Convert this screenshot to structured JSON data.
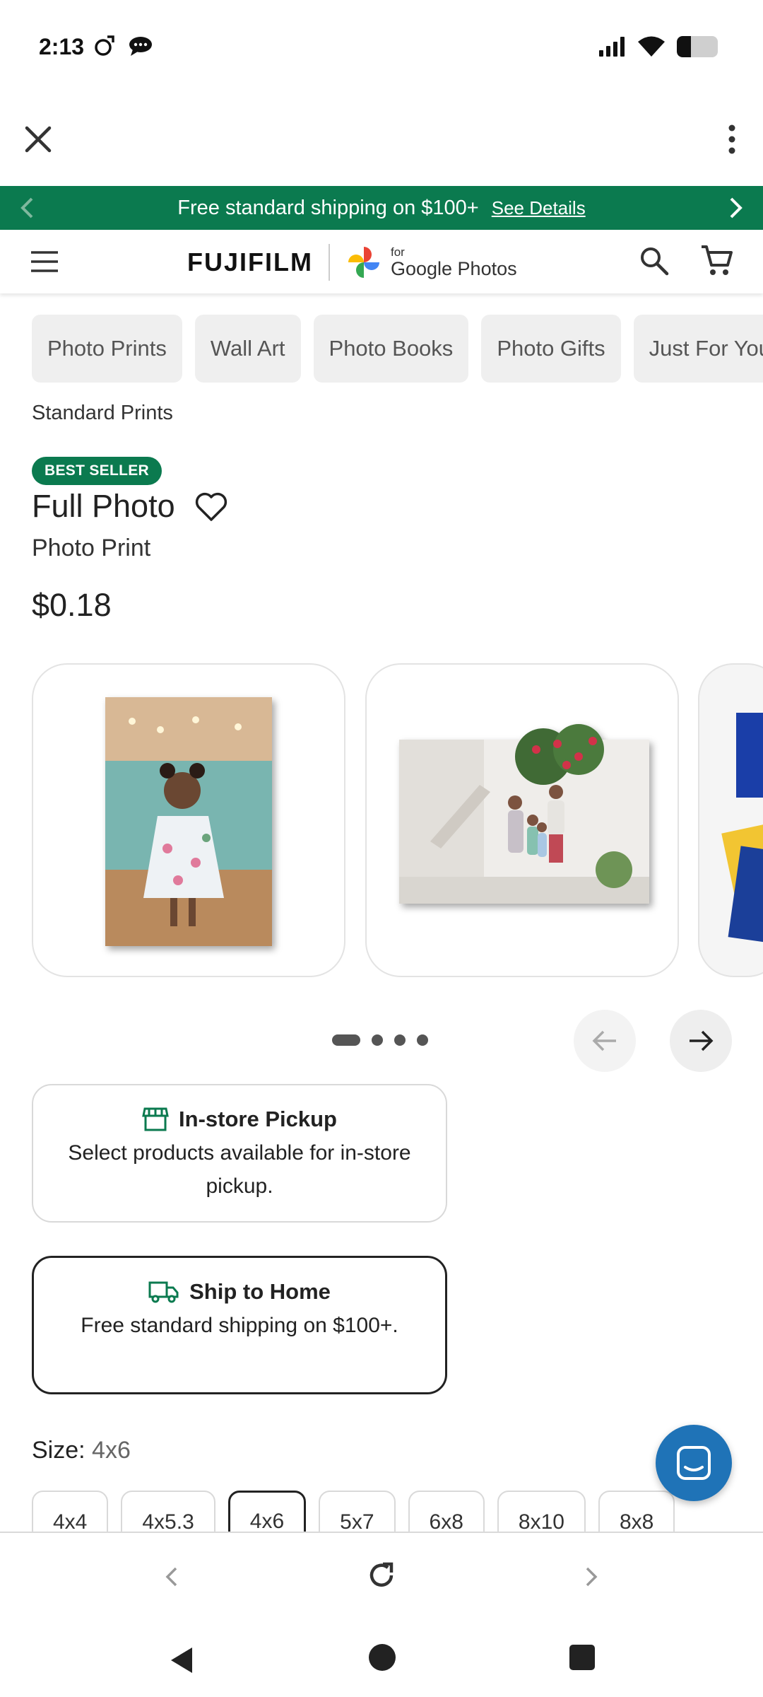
{
  "status_bar": {
    "time": "2:13",
    "battery_level": 0.35
  },
  "promo_banner": {
    "text": "Free standard shipping on $100+",
    "link": "See Details",
    "background": "#0b7a4f"
  },
  "header": {
    "brand": "FUJIFILM",
    "partner_for": "for",
    "partner_name": "Google Photos"
  },
  "categories": [
    "Photo Prints",
    "Wall Art",
    "Photo Books",
    "Photo Gifts",
    "Just For You"
  ],
  "breadcrumb": "Standard Prints",
  "product": {
    "badge": "BEST SELLER",
    "title": "Full Photo",
    "subtitle": "Photo Print",
    "price": "$0.18"
  },
  "carousel": {
    "slides": [
      "girl-portrait-print",
      "family-landscape-print",
      "print-stack"
    ],
    "active_index": 0,
    "total": 4
  },
  "delivery": {
    "pickup": {
      "title": "In-store Pickup",
      "description": "Select products available for in-store pickup."
    },
    "ship": {
      "title": "Ship to Home",
      "description": "Free standard shipping on $100+."
    }
  },
  "size": {
    "label": "Size:",
    "selected": "4x6",
    "options": [
      "4x4",
      "4x5.3",
      "4x6",
      "5x7",
      "6x8",
      "8x10",
      "8x8"
    ]
  },
  "colors": {
    "accent_green": "#0b7a4f",
    "chat_blue": "#1f73b7"
  }
}
